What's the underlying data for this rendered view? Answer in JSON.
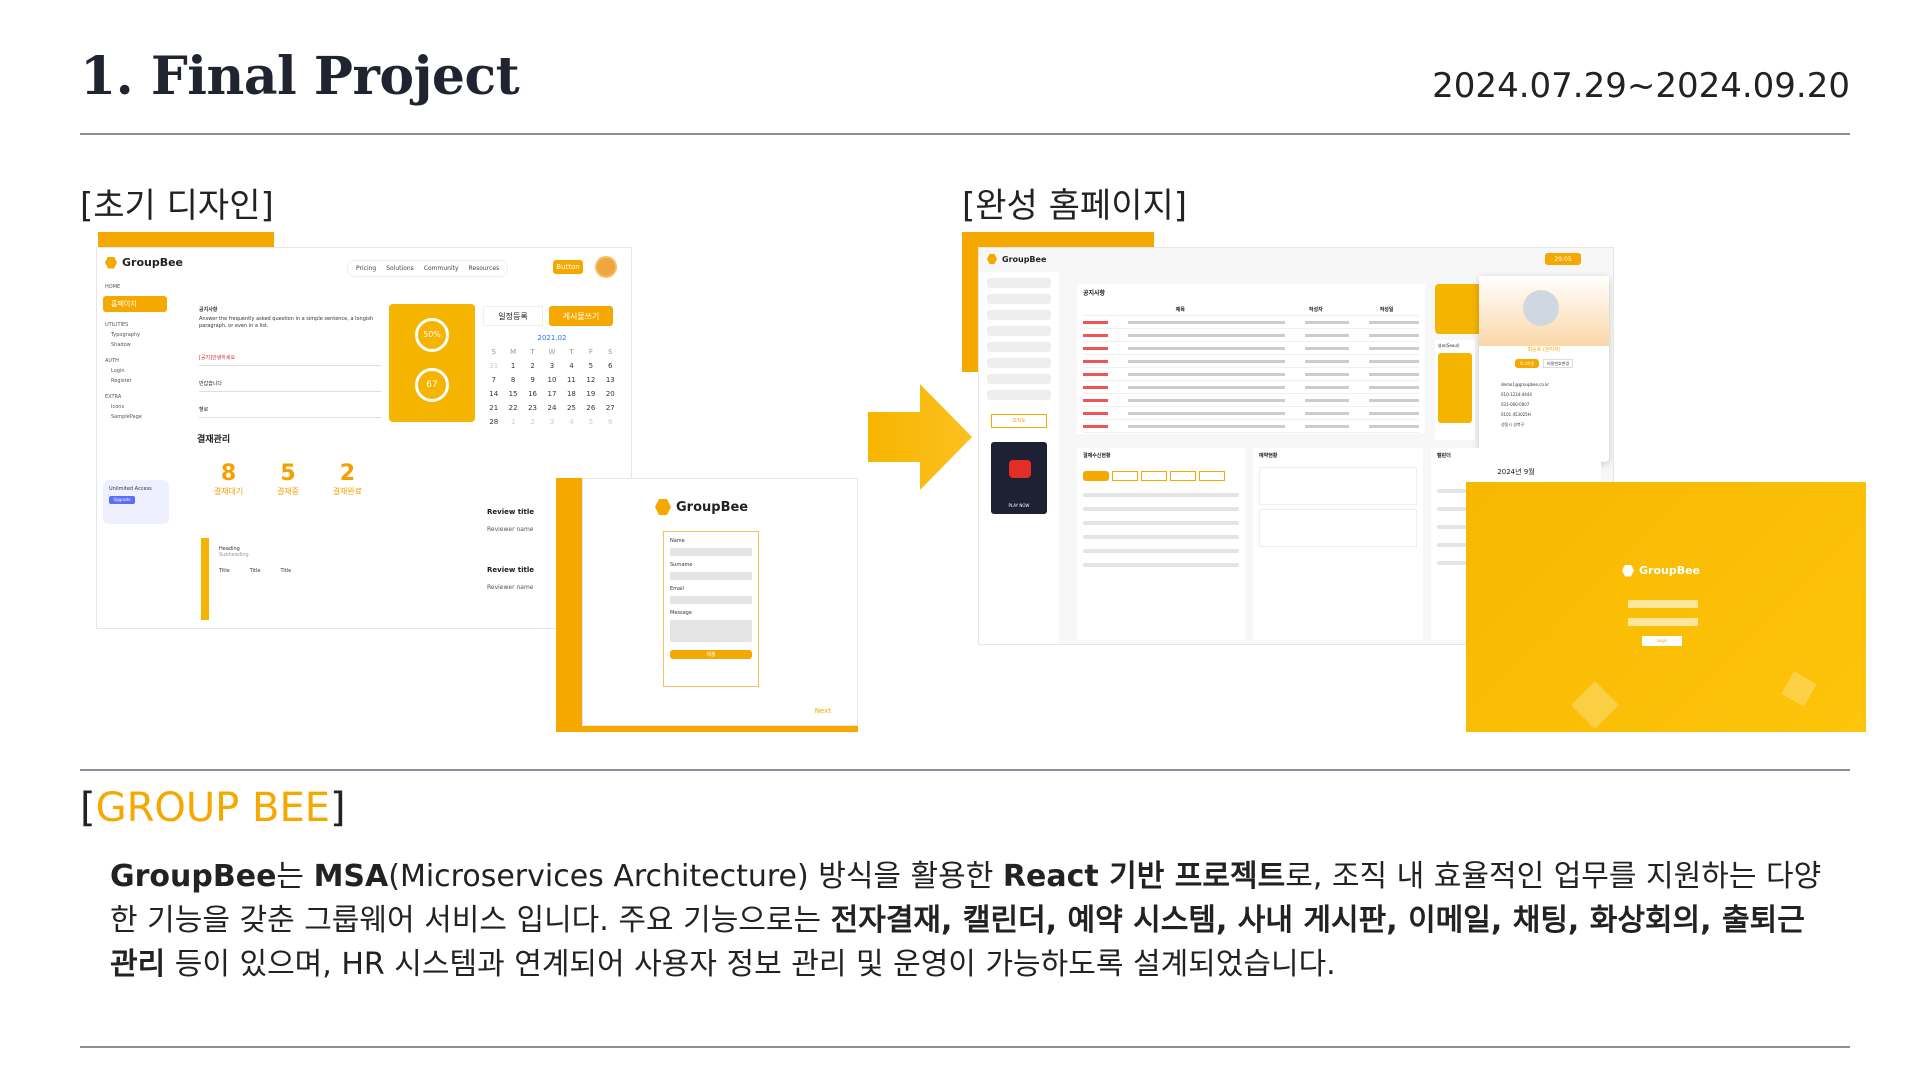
{
  "header": {
    "title": "1. Final Project",
    "date_range": "2024.07.29~2024.09.20"
  },
  "left_section": {
    "label": "[초기 디자인]",
    "mock": {
      "logo": "GroupBee",
      "nav": [
        "Pricing",
        "Solutions",
        "Community",
        "Resources"
      ],
      "nav_button": "Button",
      "sidebar_home": "HOME",
      "sidebar_active": "홈페이지",
      "sidebar_groups": [
        {
          "head": "UTILITIES",
          "items": [
            "Typography",
            "Shadow"
          ]
        },
        {
          "head": "AUTH",
          "items": [
            "Login",
            "Register"
          ]
        },
        {
          "head": "EXTRA",
          "items": [
            "Icons",
            "SamplePage"
          ]
        }
      ],
      "unlimited": "Unlimited Access",
      "upgrade": "Upgrade",
      "notice_title": "공지사항",
      "notice_text": "Answer the frequently asked question in a simple sentence, a longish paragraph, or even in a list.",
      "dropdowns": [
        "[공지]안녕하세요",
        "반갑습니다",
        "헬로"
      ],
      "gauge_1": "50%",
      "gauge_2": "67",
      "btn_schedule": "일정등록",
      "btn_write": "게시물쓰기",
      "cal_month": "2021.02",
      "cal_days": [
        "S",
        "M",
        "T",
        "W",
        "T",
        "F",
        "S"
      ],
      "cal_dates": [
        "31",
        "1",
        "2",
        "3",
        "4",
        "5",
        "6",
        "7",
        "8",
        "9",
        "10",
        "11",
        "12",
        "13",
        "14",
        "15",
        "16",
        "17",
        "18",
        "19",
        "20",
        "21",
        "22",
        "23",
        "24",
        "25",
        "26",
        "27",
        "28",
        "1",
        "2",
        "3",
        "4",
        "5",
        "6"
      ],
      "approval_title": "결재관리",
      "stats": [
        {
          "value": "8",
          "label": "결재대기"
        },
        {
          "value": "5",
          "label": "결재중"
        },
        {
          "value": "2",
          "label": "결재완료"
        }
      ],
      "heading": "Heading",
      "subheading": "Subheading",
      "cards": [
        "Title",
        "Title",
        "Title"
      ],
      "reviews": [
        {
          "title": "Review title",
          "name": "Reviewer name",
          "date": "Date"
        },
        {
          "title": "Review title",
          "name": "Reviewer name",
          "date": "Date"
        }
      ],
      "form_logo": "GroupBee",
      "form_fields": [
        "Name",
        "Surname",
        "Email",
        "Message"
      ],
      "form_submit": "제출",
      "next": "Next"
    }
  },
  "right_section": {
    "label": "[완성 홈페이지]",
    "mock": {
      "logo": "GroupBee",
      "timer": "29:05",
      "notice_title": "공지사항",
      "notice_cols": [
        "제목",
        "작성자",
        "작성일"
      ],
      "notice_rows": 9,
      "approval_title": "결재수신현황",
      "booking_title": "예약현황",
      "calendar_title": "캘린더",
      "calendar_month": "2024년 9월",
      "weather_label": "날씨(Seoul)",
      "profile_name": "최승호 (관리자)",
      "profile_btn1": "로그아웃",
      "profile_btn2": "비밀번호변경",
      "profile_items": [
        "demo1@groupbee.co.kr",
        "010-1234-4444",
        "031-000-0007",
        "0101 453025H",
        "성동시 성북구"
      ],
      "login_logo": "GroupBee",
      "login_btn": "Login",
      "play_now": "PLAY NOW",
      "side_btn": "조직도"
    }
  },
  "groupbee": {
    "bracket_open": "[",
    "name": "GROUP BEE",
    "bracket_close": "]",
    "desc_parts": [
      {
        "t": "GroupBee",
        "b": true
      },
      {
        "t": "는 ",
        "b": false
      },
      {
        "t": "MSA",
        "b": true
      },
      {
        "t": "(Microservices Architecture) 방식을 활용한 ",
        "b": false
      },
      {
        "t": "React 기반 프로젝트",
        "b": true
      },
      {
        "t": "로, 조직 내 효율적인 업무를 지원하는 다양한 기능을 갖춘 그룹웨어 서비스 입니다. 주요 기능으로는 ",
        "b": false
      },
      {
        "t": "전자결재, 캘린더, 예약 시스템, 사내 게시판, 이메일, 채팅, 화상회의, 출퇴근 관리",
        "b": true
      },
      {
        "t": " 등이 있으며, HR 시스템과 연계되어 사용자 정보 관리 및 운영이 가능하도록 설계되었습니다.",
        "b": false
      }
    ]
  },
  "colors": {
    "accent": "#f5a800",
    "text": "#222222",
    "rule": "#8a9099"
  }
}
